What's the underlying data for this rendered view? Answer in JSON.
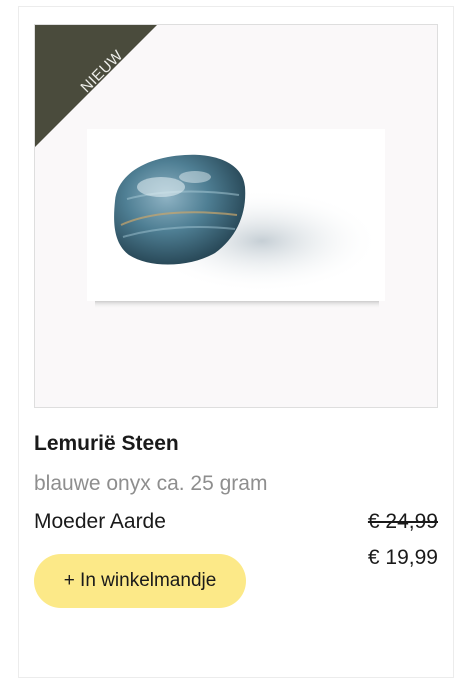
{
  "product": {
    "badge": "NIEUW",
    "title": "Lemurië Steen",
    "subtitle": "blauwe onyx ca. 25 gram",
    "brand": "Moeder Aarde",
    "old_price": "€ 24,99",
    "new_price": "€ 19,99",
    "cart_label": "+ In winkelmandje"
  },
  "colors": {
    "badge_bg": "#4a4b3c",
    "button_bg": "#fce988",
    "muted_text": "#8e8e8e"
  }
}
